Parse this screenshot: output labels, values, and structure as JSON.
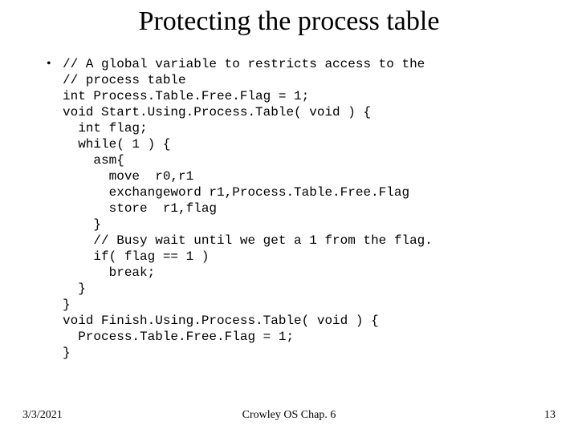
{
  "title": "Protecting the process table",
  "bullet": "•",
  "code": "// A global variable to restricts access to the\n// process table\nint Process.Table.Free.Flag = 1;\nvoid Start.Using.Process.Table( void ) {\n  int flag;\n  while( 1 ) {\n    asm{\n      move  r0,r1\n      exchangeword r1,Process.Table.Free.Flag\n      store  r1,flag\n    }\n    // Busy wait until we get a 1 from the flag.\n    if( flag == 1 )\n      break;\n  }\n}\nvoid Finish.Using.Process.Table( void ) {\n  Process.Table.Free.Flag = 1;\n}",
  "footer": {
    "date": "3/3/2021",
    "center": "Crowley     OS       Chap. 6",
    "page": "13"
  }
}
